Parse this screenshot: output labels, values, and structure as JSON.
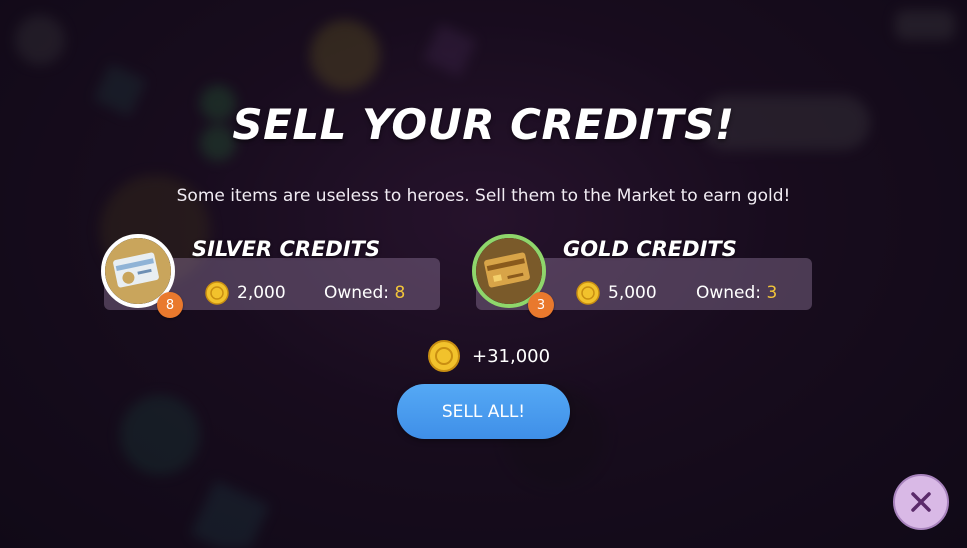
{
  "modal": {
    "title": "SELL YOUR CREDITS!",
    "subtitle": "Some items are useless to heroes. Sell them to the Market to earn gold!"
  },
  "items": [
    {
      "name": "SILVER CREDITS",
      "price": "2,000",
      "owned_label": "Owned: ",
      "owned": "8",
      "badge": "8",
      "icon": "silver-credit-card-icon",
      "ring_color": "#ffffff"
    },
    {
      "name": "GOLD CREDITS",
      "price": "5,000",
      "owned_label": "Owned: ",
      "owned": "3",
      "badge": "3",
      "icon": "gold-credit-card-icon",
      "ring_color": "#8fd66b"
    }
  ],
  "total": "+31,000",
  "sell_button": "SELL ALL!",
  "close_icon": "close-icon",
  "colors": {
    "accent_button": "#4a9cf0",
    "owned_number": "#f2c53a",
    "badge": "#e9792d",
    "close_button": "#d9b9e6"
  }
}
